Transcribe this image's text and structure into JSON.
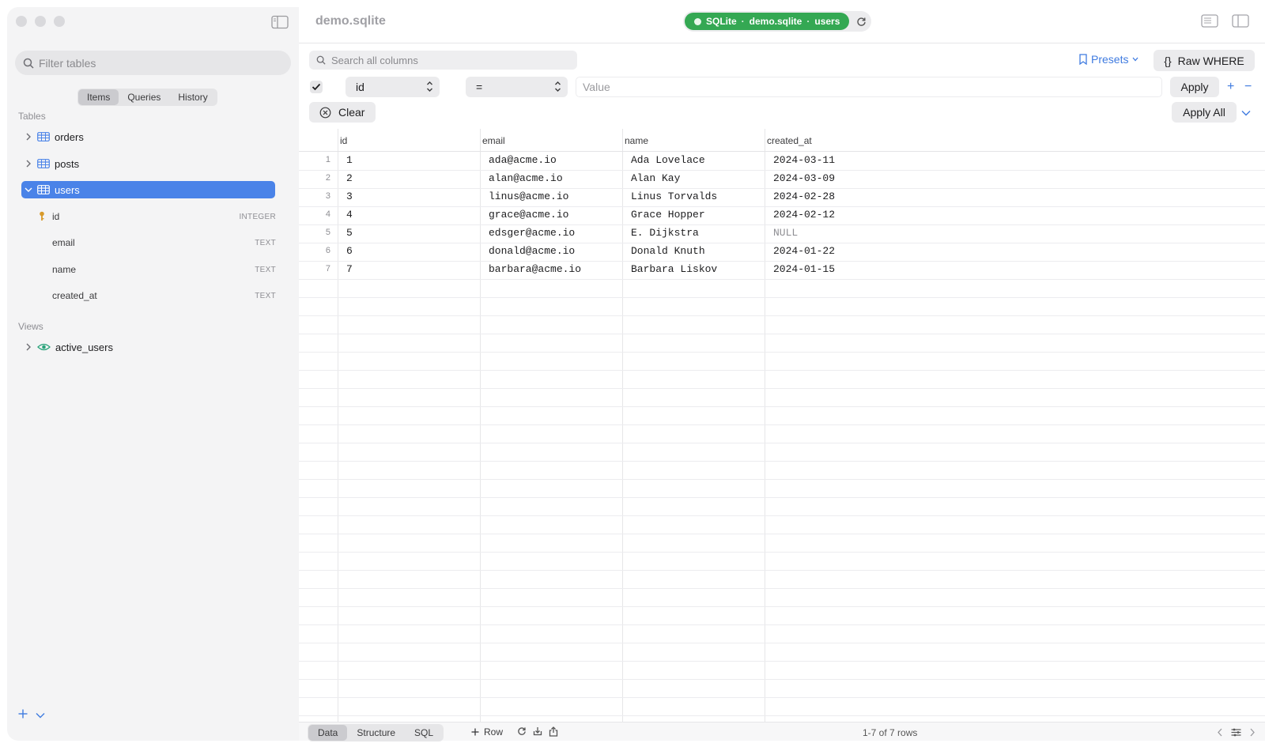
{
  "sidebar": {
    "filter_placeholder": "Filter tables",
    "tabs": [
      "Items",
      "Queries",
      "History"
    ],
    "tables_label": "Tables",
    "tables": [
      "orders",
      "posts",
      "users"
    ],
    "columns": [
      {
        "name": "id",
        "type": "INTEGER"
      },
      {
        "name": "email",
        "type": "TEXT"
      },
      {
        "name": "name",
        "type": "TEXT"
      },
      {
        "name": "created_at",
        "type": "TEXT"
      }
    ],
    "views_label": "Views",
    "views": [
      "active_users"
    ]
  },
  "header": {
    "title": "demo.sqlite",
    "status": {
      "engine": "SQLite",
      "database": "demo.sqlite",
      "table": "users",
      "sep": "·",
      "color": "#34a853"
    }
  },
  "toolbar": {
    "search_placeholder": "Search all columns",
    "presets_label": "Presets",
    "raw_where_label": "Raw WHERE",
    "raw_where_icon": "{}",
    "filter_column": "id",
    "filter_operator": "=",
    "filter_value_placeholder": "Value",
    "apply_label": "Apply",
    "clear_label": "Clear",
    "apply_all_label": "Apply All",
    "plus": "+",
    "minus": "−"
  },
  "grid": {
    "columns": [
      "id",
      "email",
      "name",
      "created_at"
    ],
    "rows": [
      [
        "1",
        "1",
        "ada@acme.io",
        "Ada Lovelace",
        "2024-03-11"
      ],
      [
        "2",
        "2",
        "alan@acme.io",
        "Alan Kay",
        "2024-03-09"
      ],
      [
        "3",
        "3",
        "linus@acme.io",
        "Linus Torvalds",
        "2024-02-28"
      ],
      [
        "4",
        "4",
        "grace@acme.io",
        "Grace Hopper",
        "2024-02-12"
      ],
      [
        "5",
        "5",
        "edsger@acme.io",
        "E. Dijkstra",
        "NULL"
      ],
      [
        "6",
        "6",
        "donald@acme.io",
        "Donald Knuth",
        "2024-01-22"
      ],
      [
        "7",
        "7",
        "barbara@acme.io",
        "Barbara Liskov",
        "2024-01-15"
      ]
    ]
  },
  "footer": {
    "tabs": [
      "Data",
      "Structure",
      "SQL"
    ],
    "add_row_label": "Row",
    "row_count": "1-7 of 7 rows"
  },
  "colors": {
    "accent": "#4a83e8",
    "link": "#3f7be0"
  }
}
